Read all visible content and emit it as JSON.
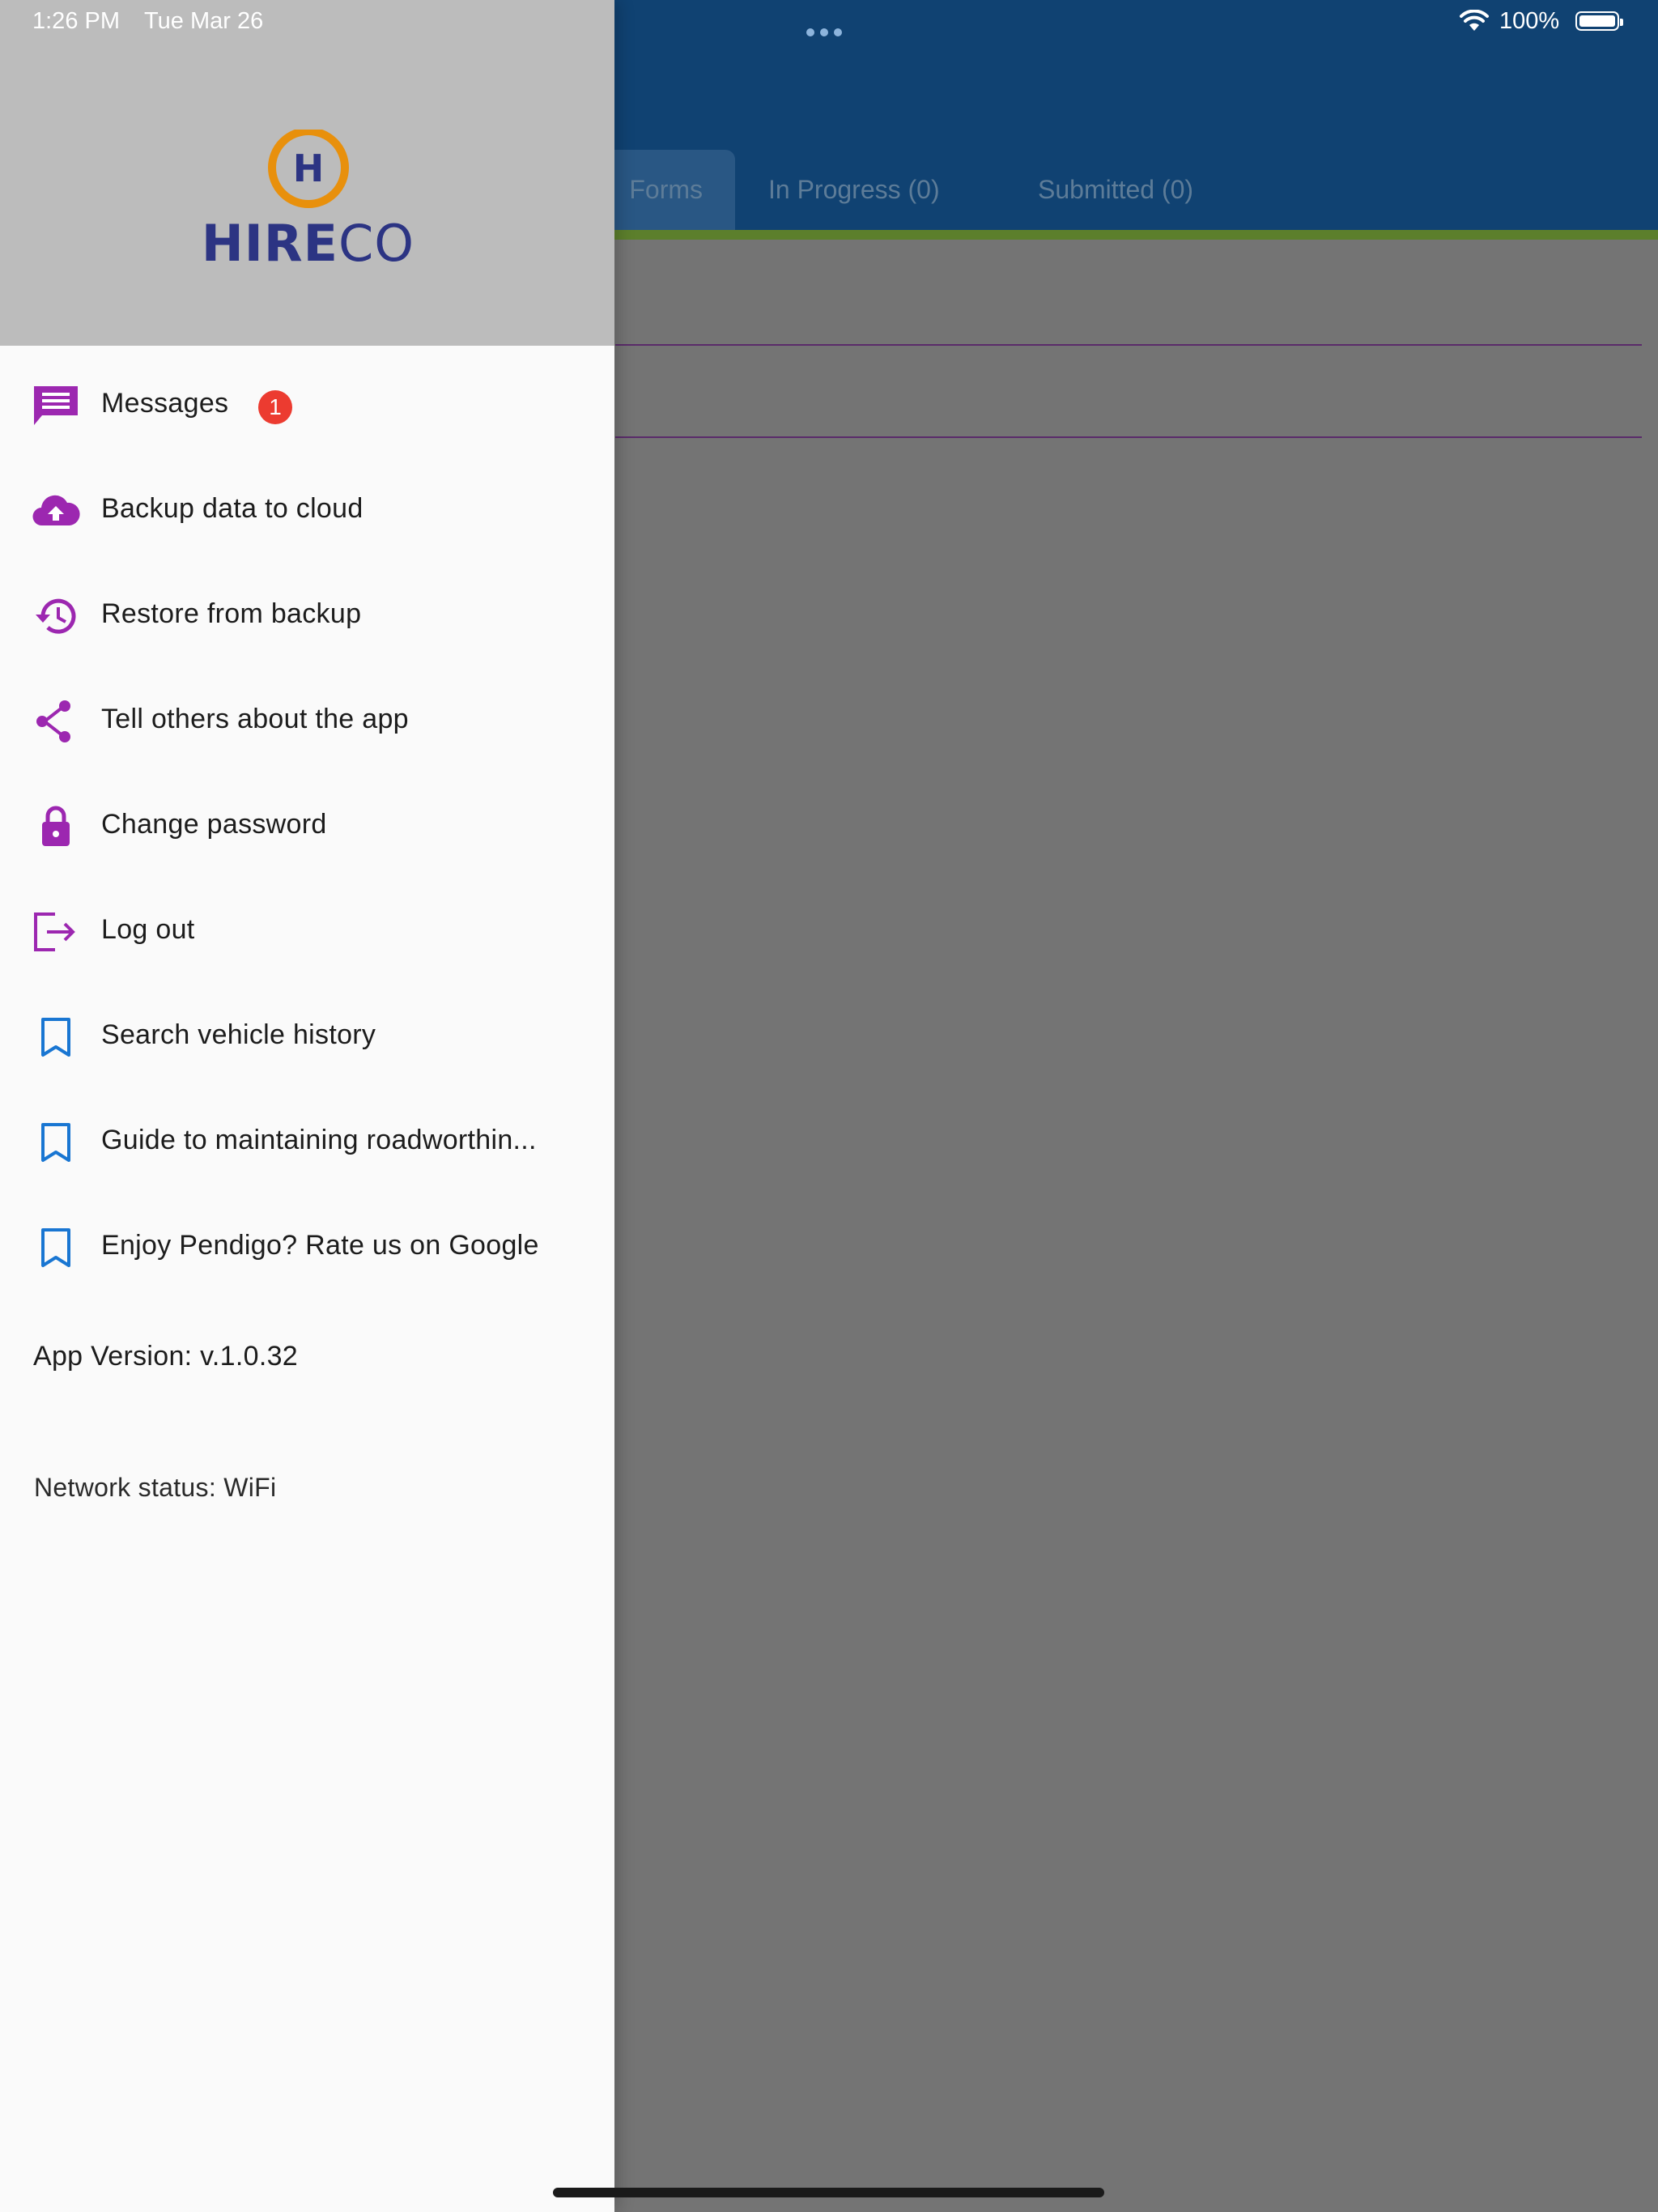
{
  "status_bar": {
    "time": "1:26 PM",
    "date": "Tue Mar 26",
    "battery_pct": "100%",
    "battery_level": 1.0
  },
  "colors": {
    "header_blue": "#104272",
    "accent_purple": "#9c27b0",
    "bookmark_blue": "#1976d2",
    "badge_red": "#ec3b30",
    "logo_navy": "#2c3483",
    "logo_orange": "#e8900c"
  },
  "background_app": {
    "tabs": [
      {
        "label": "Forms",
        "active": true
      },
      {
        "label": "In Progress (0)",
        "active": false
      },
      {
        "label": "Submitted (0)",
        "active": false
      }
    ]
  },
  "drawer": {
    "logo": {
      "mark": "H",
      "text_bold": "HIRE",
      "text_light": "CO"
    },
    "menu": [
      {
        "label": "Messages",
        "icon": "message-icon",
        "badge": "1"
      },
      {
        "label": "Backup data to cloud",
        "icon": "cloud-upload-icon"
      },
      {
        "label": "Restore from backup",
        "icon": "history-icon"
      },
      {
        "label": "Tell others about the app",
        "icon": "share-icon"
      },
      {
        "label": "Change password",
        "icon": "lock-icon"
      },
      {
        "label": "Log out",
        "icon": "logout-icon"
      },
      {
        "label": "Search vehicle history",
        "icon": "bookmark-icon"
      },
      {
        "label": "Guide to maintaining roadworthin...",
        "icon": "bookmark-icon"
      },
      {
        "label": "Enjoy Pendigo? Rate us on Google",
        "icon": "bookmark-icon"
      }
    ],
    "version_text": "App Version: v.1.0.32",
    "network_text": "Network status: WiFi"
  }
}
